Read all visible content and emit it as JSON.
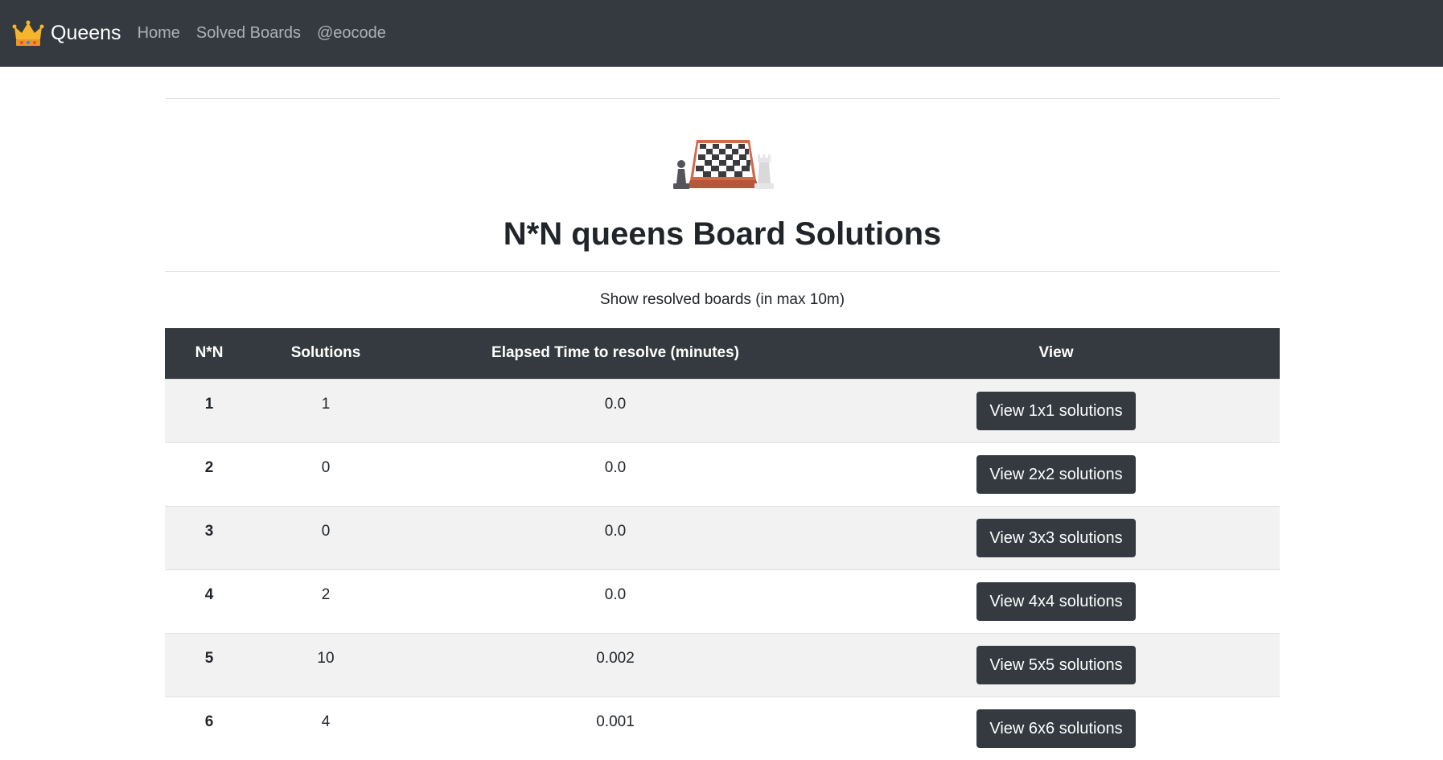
{
  "navbar": {
    "brand": "Queens",
    "links": [
      "Home",
      "Solved Boards",
      "@eocode"
    ],
    "brand_icon": "crown-icon"
  },
  "hero": {
    "icon": "chess-board-icon",
    "title": "N*N queens Board Solutions",
    "subtitle": "Show resolved boards (in max 10m)"
  },
  "table": {
    "headers": [
      "N*N",
      "Solutions",
      "Elapsed Time to resolve (minutes)",
      "View"
    ],
    "rows": [
      {
        "n": "1",
        "solutions": "1",
        "time": "0.0",
        "button": "View 1x1 solutions"
      },
      {
        "n": "2",
        "solutions": "0",
        "time": "0.0",
        "button": "View 2x2 solutions"
      },
      {
        "n": "3",
        "solutions": "0",
        "time": "0.0",
        "button": "View 3x3 solutions"
      },
      {
        "n": "4",
        "solutions": "2",
        "time": "0.0",
        "button": "View 4x4 solutions"
      },
      {
        "n": "5",
        "solutions": "10",
        "time": "0.002",
        "button": "View 5x5 solutions"
      },
      {
        "n": "6",
        "solutions": "4",
        "time": "0.001",
        "button": "View 6x6 solutions"
      }
    ]
  },
  "colors": {
    "navbar_bg": "#343a40",
    "button_bg": "#343a40",
    "stripe": "#f2f2f2",
    "crown": "#f5a623"
  }
}
